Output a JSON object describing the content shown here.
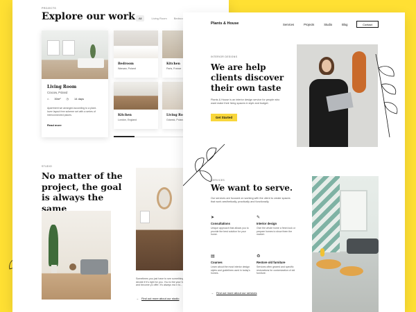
{
  "left": {
    "projects_label": "PROJECTS",
    "title": "Explore our work",
    "filters": [
      "All",
      "Living Room",
      "Bedroom"
    ],
    "featured": {
      "title": "Living Room",
      "location": "Cracow, Poland",
      "area": "30m²",
      "duration": "14 days",
      "description": "Apartment we arranged according to a plant-lover layout free scheme set with a series of interconnected places.",
      "link": "Read more"
    },
    "grid": [
      {
        "title": "Bedroom",
        "location": "Warsaw, Poland"
      },
      {
        "title": "Kitchen",
        "location": "Paris, France"
      },
      {
        "title": "Kitchen",
        "location": "London, England"
      },
      {
        "title": "Living Room",
        "location": "Gdansk, Poland"
      }
    ],
    "studio_label": "STUDIO",
    "headline": "No matter of the project, the goal is always the same",
    "studio_text": "Sometimes you just have to see something to decide if it's right for you. You to the your home and become yo offer. It's always ma n to...",
    "studio_link": "Find out more about our studio"
  },
  "right": {
    "brand": "Plants & House",
    "nav": [
      "Services",
      "Projects",
      "Studio",
      "Blog"
    ],
    "contact": "Contact",
    "hero_label": "INTERIOR DESIGNS",
    "hero_title": "We are help clients discover their own taste",
    "hero_text": "Plants & House is an interior design service for people who want make their living spaces in style and budget.",
    "cta": "Get Started",
    "services_label": "SERVICES",
    "services_title": "We want to serve.",
    "services_text": "Our services are focused on working with the client to create spaces that work aesthetically, practically and functionally.",
    "services": [
      {
        "icon": "paper-plane-icon",
        "title": "Consultations",
        "text": "Unique approach that allows you to provide the best solution for your home."
      },
      {
        "icon": "pencil-icon",
        "title": "Interior design",
        "text": "Give the whole home a fresh look or prepare homes to show them the market."
      },
      {
        "icon": "book-icon",
        "title": "Courses",
        "text": "Learn about the most interior design styles and guidelines used in today's homes."
      },
      {
        "icon": "recycle-icon",
        "title": "Restore old furniture",
        "text": "Services often geared and specific restorations for customization of old furniture."
      }
    ],
    "services_link": "Find out more about our services"
  },
  "colors": {
    "background": "#FFE033",
    "accent": "#F8D63B",
    "text": "#111111"
  }
}
